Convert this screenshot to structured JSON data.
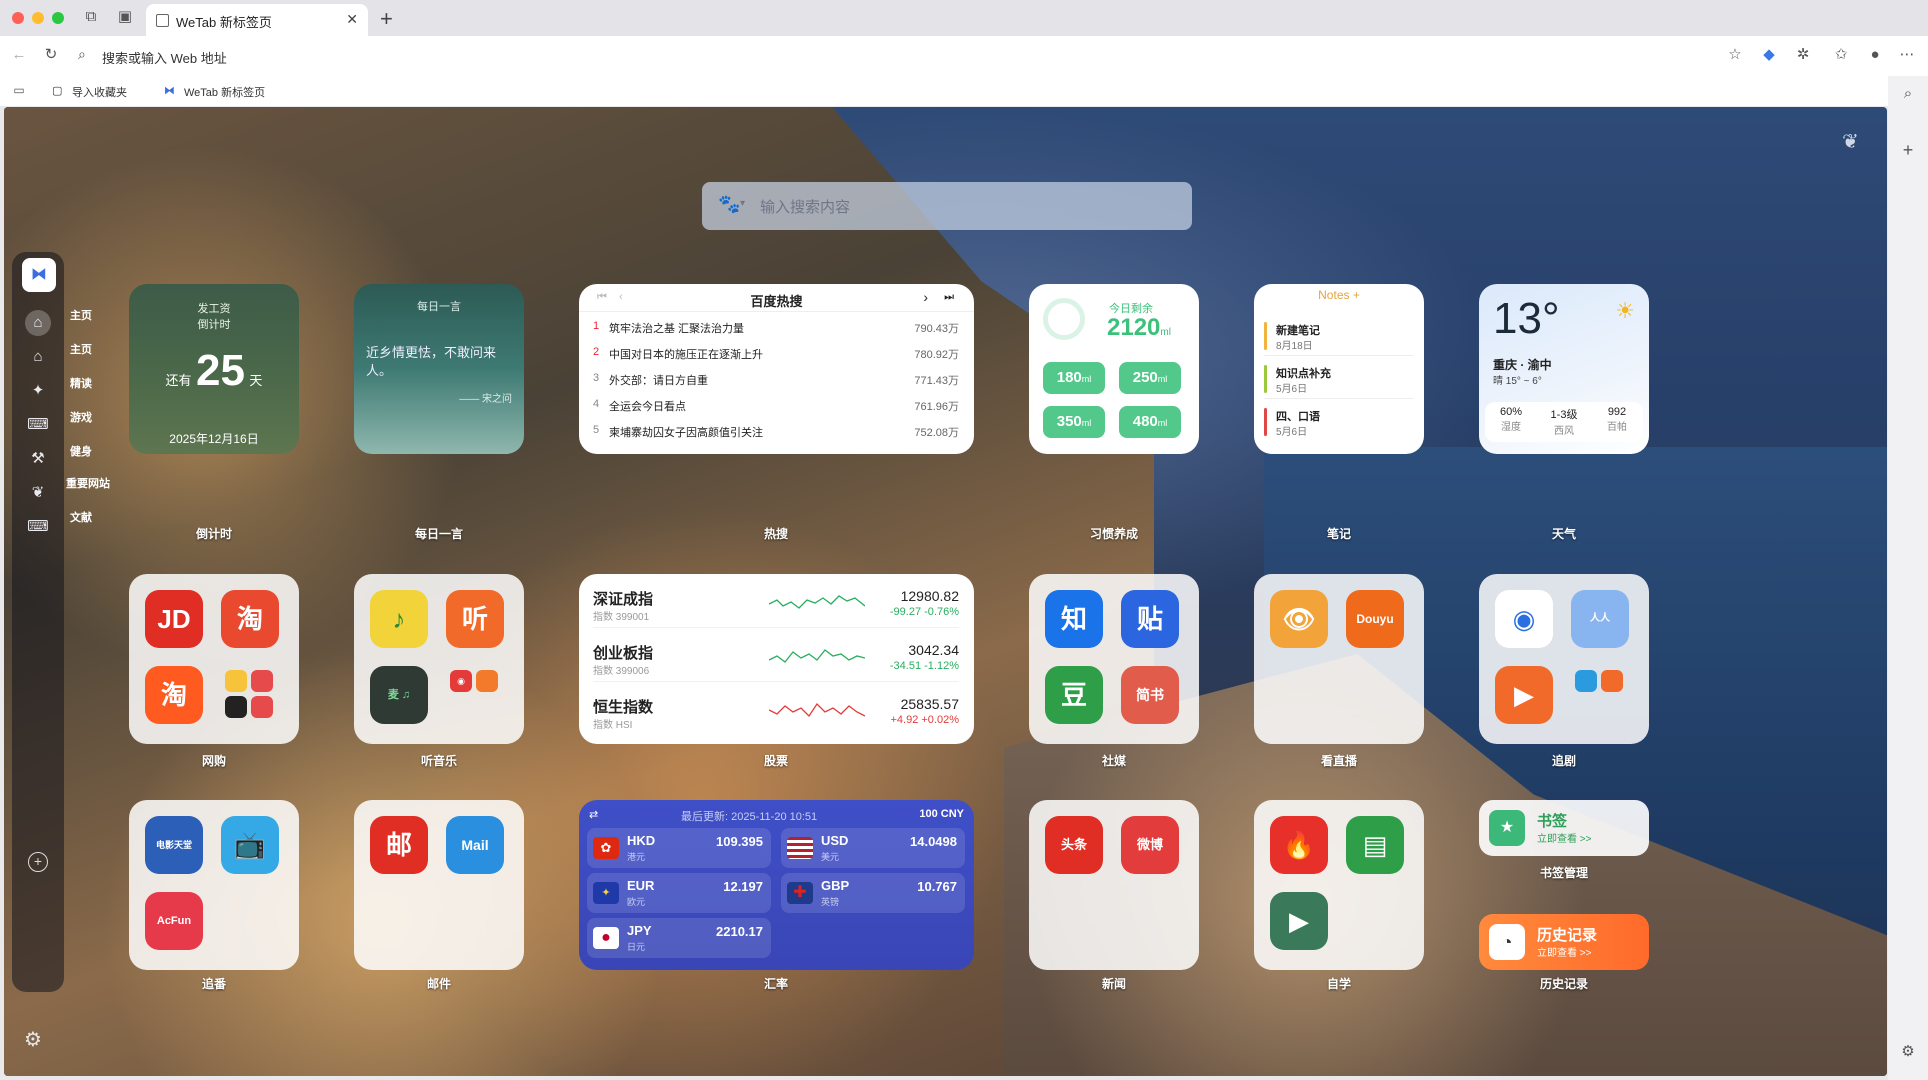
{
  "browser": {
    "tab_title": "WeTab 新标签页",
    "address_placeholder": "搜索或输入 Web 地址",
    "bookmarks": [
      "导入收藏夹",
      "WeTab 新标签页"
    ]
  },
  "search": {
    "placeholder": "输入搜索内容"
  },
  "sidebar": {
    "items": [
      {
        "label": "主页",
        "icon": "home-icon"
      },
      {
        "label": "主页",
        "icon": "home-icon"
      },
      {
        "label": "精读",
        "icon": "compass-icon"
      },
      {
        "label": "游戏",
        "icon": "gamepad-icon"
      },
      {
        "label": "健身",
        "icon": "dumbbell-icon"
      },
      {
        "label": "重要网站",
        "icon": "leaf-icon"
      },
      {
        "label": "文献",
        "icon": "book-icon"
      }
    ]
  },
  "widgets": {
    "countdown": {
      "title": "发工资",
      "subtitle": "倒计时",
      "prefix": "还有",
      "days": "25",
      "suffix": "天",
      "date": "2025年12月16日",
      "label": "倒计时"
    },
    "quote": {
      "header": "每日一言",
      "text": "近乡情更怯，不敢问来人。",
      "author": "—— 宋之问",
      "label": "每日一言"
    },
    "hot": {
      "title": "百度热搜",
      "label": "热搜",
      "items": [
        {
          "rank": "1",
          "title": "筑牢法治之基 汇聚法治力量",
          "value": "790.43万"
        },
        {
          "rank": "2",
          "title": "中国对日本的施压正在逐渐上升",
          "value": "780.92万"
        },
        {
          "rank": "3",
          "title": "外交部：请日方自重",
          "value": "771.43万"
        },
        {
          "rank": "4",
          "title": "全运会今日看点",
          "value": "761.96万"
        },
        {
          "rank": "5",
          "title": "柬埔寨劫囚女子因高颜值引关注",
          "value": "752.08万"
        }
      ]
    },
    "water": {
      "remaining_label": "今日剩余",
      "remaining": "2120",
      "unit": "ml",
      "buttons": [
        "180",
        "250",
        "350",
        "480"
      ],
      "label": "习惯养成"
    },
    "notes": {
      "header": "Notes +",
      "label": "笔记",
      "items": [
        {
          "title": "新建笔记",
          "date": "8月18日",
          "color": "#f0b43c"
        },
        {
          "title": "知识点补充",
          "date": "5月6日",
          "color": "#9bc93c"
        },
        {
          "title": "四、口语",
          "date": "5月6日",
          "color": "#e04848"
        }
      ]
    },
    "weather": {
      "temp": "13°",
      "location": "重庆 · 渝中",
      "range": "晴 15° ~ 6°",
      "label": "天气",
      "stats": [
        {
          "value": "60%",
          "name": "湿度"
        },
        {
          "value": "1-3级",
          "name": "西风"
        },
        {
          "value": "992",
          "name": "百帕"
        }
      ]
    },
    "shopping": {
      "label": "网购",
      "apps": [
        "JD",
        "淘",
        "淘"
      ]
    },
    "music": {
      "label": "听音乐",
      "apps": [
        "♪",
        "听",
        "麦 ♫"
      ]
    },
    "stocks": {
      "label": "股票",
      "items": [
        {
          "name": "深证成指",
          "code": "指数 399001",
          "price": "12980.82",
          "change": "-99.27 -0.76%",
          "color": "#27ae60"
        },
        {
          "name": "创业板指",
          "code": "指数 399006",
          "price": "3042.34",
          "change": "-34.51 -1.12%",
          "color": "#27ae60"
        },
        {
          "name": "恒生指数",
          "code": "指数 HSI",
          "price": "25835.57",
          "change": "+4.92 +0.02%",
          "color": "#e23b3b"
        }
      ]
    },
    "social": {
      "label": "社媒",
      "apps": [
        "知",
        "贴",
        "豆",
        "简书"
      ]
    },
    "live": {
      "label": "看直播"
    },
    "drama": {
      "label": "追剧"
    },
    "anime": {
      "label": "追番",
      "apps": [
        "电影天堂",
        "AcFun"
      ]
    },
    "mail": {
      "label": "邮件",
      "apps": [
        "邮",
        "Mail"
      ]
    },
    "fx": {
      "label": "汇率",
      "updated": "最后更新: 2025-11-20 10:51",
      "base": "100 CNY",
      "items": [
        {
          "code": "HKD",
          "name": "港元",
          "rate": "109.395"
        },
        {
          "code": "USD",
          "name": "美元",
          "rate": "14.0498"
        },
        {
          "code": "EUR",
          "name": "欧元",
          "rate": "12.197"
        },
        {
          "code": "GBP",
          "name": "英镑",
          "rate": "10.767"
        },
        {
          "code": "JPY",
          "name": "日元",
          "rate": "2210.17"
        }
      ]
    },
    "news": {
      "label": "新闻",
      "apps": [
        "头条",
        "微博"
      ]
    },
    "study": {
      "label": "自学"
    },
    "bookmark": {
      "title": "书签",
      "sub": "立即查看 >>",
      "label": "书签管理"
    },
    "history": {
      "title": "历史记录",
      "sub": "立即查看 >>",
      "label": "历史记录"
    }
  }
}
